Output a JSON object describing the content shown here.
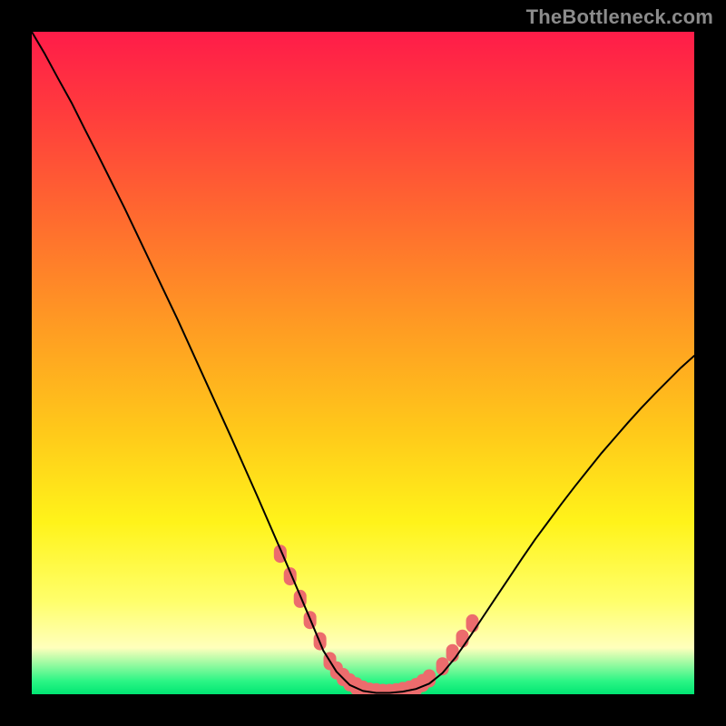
{
  "watermark": {
    "text": "TheBottleneck.com"
  },
  "colors": {
    "background": "#000000",
    "curve": "#000000",
    "marker": "#ec6c6d",
    "gradient_stops": [
      "#ff1c49",
      "#ff3b3d",
      "#ff6a2f",
      "#ff9a23",
      "#ffc81a",
      "#fff31a",
      "#ffff6b",
      "#ffffbc",
      "#2cf585",
      "#00e673"
    ]
  },
  "chart_data": {
    "type": "line",
    "title": "",
    "xlabel": "",
    "ylabel": "",
    "xlim": [
      0,
      100
    ],
    "ylim": [
      0,
      100
    ],
    "x": [
      0,
      2,
      4,
      6,
      8,
      10,
      12,
      14,
      16,
      18,
      20,
      22,
      24,
      26,
      28,
      30,
      32,
      34,
      36,
      38,
      40,
      42,
      44,
      46,
      48,
      50,
      52,
      54,
      56,
      58,
      60,
      62,
      64,
      66,
      68,
      70,
      72,
      74,
      76,
      78,
      80,
      82,
      84,
      86,
      88,
      90,
      92,
      94,
      96,
      98,
      100
    ],
    "values": [
      100,
      96.6,
      92.9,
      89.3,
      85.3,
      81.4,
      77.4,
      73.4,
      69.2,
      65.0,
      60.8,
      56.6,
      52.2,
      47.8,
      43.4,
      39.0,
      34.5,
      30.0,
      25.4,
      20.8,
      16.1,
      11.4,
      6.6,
      3.4,
      1.4,
      0.5,
      0.2,
      0.2,
      0.4,
      0.8,
      1.6,
      3.2,
      5.6,
      8.5,
      11.5,
      14.5,
      17.5,
      20.5,
      23.4,
      26.1,
      28.8,
      31.4,
      33.9,
      36.4,
      38.7,
      41.0,
      43.2,
      45.3,
      47.3,
      49.3,
      51.1
    ],
    "markers_x": [
      37.5,
      39,
      40.5,
      42,
      43.5,
      45,
      46,
      47,
      48,
      49,
      50,
      51,
      52,
      53,
      54,
      55,
      56,
      57,
      58,
      59,
      60,
      62,
      63.5,
      65,
      66.5
    ],
    "markers_y": [
      21.2,
      17.8,
      14.4,
      11.2,
      8.0,
      5.0,
      3.6,
      2.6,
      1.8,
      1.2,
      0.7,
      0.4,
      0.3,
      0.2,
      0.2,
      0.3,
      0.5,
      0.7,
      1.1,
      1.7,
      2.4,
      4.2,
      6.2,
      8.4,
      10.7
    ]
  }
}
